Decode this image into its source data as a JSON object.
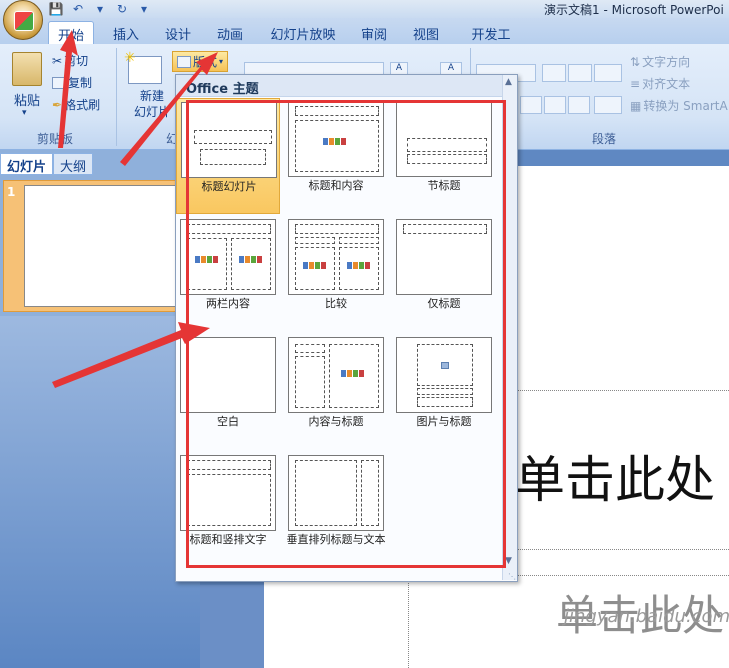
{
  "window": {
    "title": "演示文稿1 - Microsoft PowerPoi"
  },
  "ribbon_tabs": [
    "开始",
    "插入",
    "设计",
    "动画",
    "幻灯片放映",
    "审阅",
    "视图",
    "开发工具"
  ],
  "ribbon": {
    "paste_label": "粘贴",
    "cut_label": "剪切",
    "copy_label": "复制",
    "format_painter_label": "格式刷",
    "clipboard_group": "剪贴板",
    "new_slide_label": "新建\n幻灯片",
    "layout_button": "版式",
    "slides_group_partial": "幻",
    "text_direction": "文字方向",
    "align_text": "对齐文本",
    "convert_smartart": "转换为 SmartA",
    "paragraph_group": "段落"
  },
  "left_pane": {
    "tabs": [
      "幻灯片",
      "大纲"
    ],
    "slide_number": "1"
  },
  "slide": {
    "title_placeholder": "单击此处",
    "subtitle_placeholder": "单击此处",
    "watermark": "jingyan.baidu.com"
  },
  "layout_gallery": {
    "header": "Office 主题",
    "items": [
      {
        "label": "标题幻灯片",
        "selected": true
      },
      {
        "label": "标题和内容",
        "selected": false
      },
      {
        "label": "节标题",
        "selected": false
      },
      {
        "label": "两栏内容",
        "selected": false
      },
      {
        "label": "比较",
        "selected": false
      },
      {
        "label": "仅标题",
        "selected": false
      },
      {
        "label": "空白",
        "selected": false
      },
      {
        "label": "内容与标题",
        "selected": false
      },
      {
        "label": "图片与标题",
        "selected": false
      },
      {
        "label": "标题和竖排文字",
        "selected": false
      },
      {
        "label": "垂直排列标题与文本",
        "selected": false
      }
    ]
  },
  "colors": {
    "annotation_red": "#e53535",
    "selected_item": "#f9c760",
    "ribbon_text": "#15428b"
  }
}
